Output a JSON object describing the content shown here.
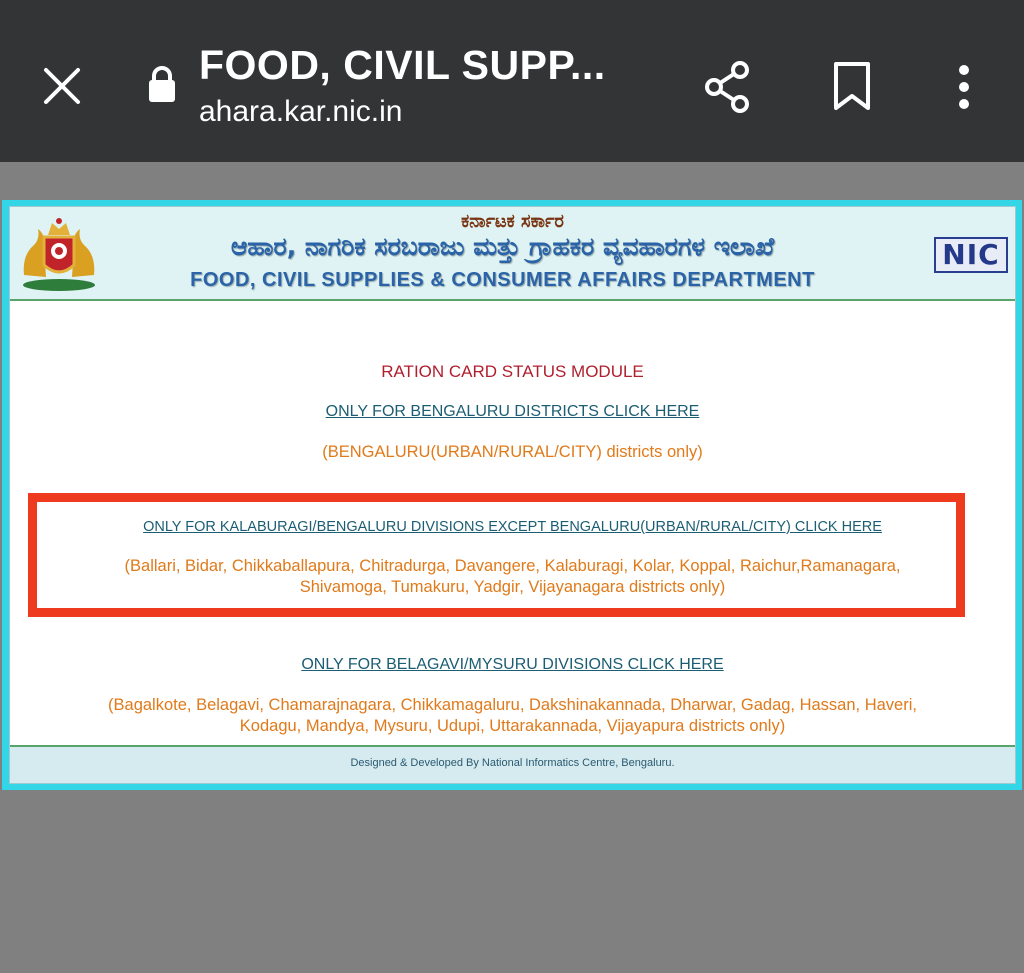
{
  "browser": {
    "tab_title": "FOOD, CIVIL SUPP...",
    "url": "ahara.kar.nic.in",
    "icons": [
      "close-icon",
      "lock-icon",
      "share-icon",
      "bookmark-icon",
      "more-vertical-icon"
    ]
  },
  "header": {
    "kannada_small": "ಕರ್ನಾಟಕ ಸರ್ಕಾರ",
    "kannada_big": "ಆಹಾರ, ನಾಗರಿಕ ಸರಬರಾಜು ಮತ್ತು ಗ್ರಾಹಕರ ವ್ಯವಹಾರಗಳ ಇಲಾಖೆ",
    "english": "FOOD, CIVIL SUPPLIES & CONSUMER AFFAIRS DEPARTMENT",
    "nic_logo": "NIC"
  },
  "main": {
    "module_title": "RATION CARD STATUS MODULE",
    "sections": [
      {
        "link": "ONLY FOR BENGALURU DISTRICTS CLICK HERE",
        "note": "(BENGALURU(URBAN/RURAL/CITY) districts only)"
      },
      {
        "link": "ONLY FOR KALABURAGI/BENGALURU DIVISIONS EXCEPT BENGALURU(URBAN/RURAL/CITY) CLICK HERE",
        "note_line1": "(Ballari, Bidar, Chikkaballapura, Chitradurga, Davangere, Kalaburagi, Kolar, Koppal, Raichur,Ramanagara,",
        "note_line2": "Shivamoga, Tumakuru, Yadgir, Vijayanagara districts only)"
      },
      {
        "link": "ONLY FOR BELAGAVI/MYSURU DIVISIONS CLICK HERE",
        "note_line1": "(Bagalkote, Belagavi, Chamarajnagara, Chikkamagaluru, Dakshinakannada, Dharwar, Gadag, Hassan, Haveri,",
        "note_line2": "Kodagu, Mandya, Mysuru, Udupi, Uttarakannada, Vijayapura districts only)"
      }
    ]
  },
  "footer": {
    "text": "Designed & Developed By National Informatics Centre, Bengaluru."
  },
  "colors": {
    "topbar": "#333436",
    "page_border": "#33d6e6",
    "highlight_border": "#ee3b1f",
    "note_text": "#e07a1a",
    "link_text": "#1b5e73",
    "module_title": "#b01f2e"
  }
}
